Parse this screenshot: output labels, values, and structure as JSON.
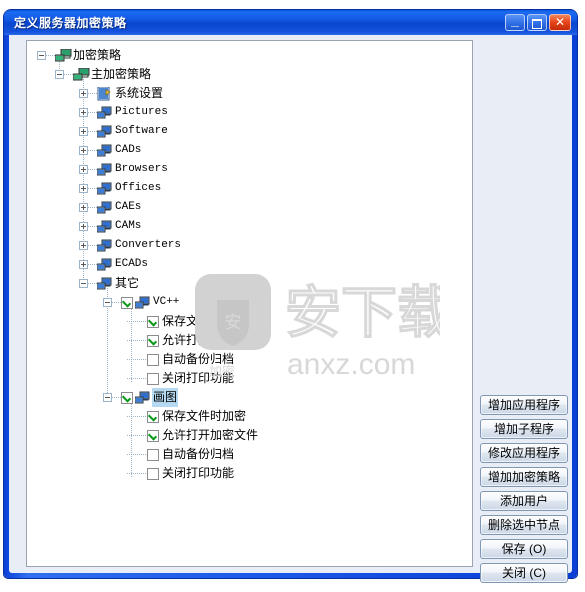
{
  "window": {
    "title": "定义服务器加密策略",
    "controls": {
      "minimize": "–",
      "maximize": "□",
      "close": "✕"
    }
  },
  "tree": {
    "nodes": [
      {
        "label": "加密策略",
        "level": 0,
        "expander": "minus",
        "icon": "policy-icon",
        "checkbox": "none",
        "selected": false,
        "mono": false
      },
      {
        "label": "主加密策略",
        "level": 1,
        "expander": "minus",
        "icon": "policy-icon",
        "checkbox": "none",
        "selected": false,
        "mono": false
      },
      {
        "label": "系统设置",
        "level": 2,
        "expander": "plus",
        "icon": "settings-icon",
        "checkbox": "none",
        "selected": false,
        "mono": false
      },
      {
        "label": "Pictures",
        "level": 2,
        "expander": "plus",
        "icon": "computer-icon",
        "checkbox": "none",
        "selected": false,
        "mono": true
      },
      {
        "label": "Software",
        "level": 2,
        "expander": "plus",
        "icon": "computer-icon",
        "checkbox": "none",
        "selected": false,
        "mono": true
      },
      {
        "label": "CADs",
        "level": 2,
        "expander": "plus",
        "icon": "computer-icon",
        "checkbox": "none",
        "selected": false,
        "mono": true
      },
      {
        "label": "Browsers",
        "level": 2,
        "expander": "plus",
        "icon": "computer-icon",
        "checkbox": "none",
        "selected": false,
        "mono": true
      },
      {
        "label": "Offices",
        "level": 2,
        "expander": "plus",
        "icon": "computer-icon",
        "checkbox": "none",
        "selected": false,
        "mono": true
      },
      {
        "label": "CAEs",
        "level": 2,
        "expander": "plus",
        "icon": "computer-icon",
        "checkbox": "none",
        "selected": false,
        "mono": true
      },
      {
        "label": "CAMs",
        "level": 2,
        "expander": "plus",
        "icon": "computer-icon",
        "checkbox": "none",
        "selected": false,
        "mono": true
      },
      {
        "label": "Converters",
        "level": 2,
        "expander": "plus",
        "icon": "computer-icon",
        "checkbox": "none",
        "selected": false,
        "mono": true
      },
      {
        "label": "ECADs",
        "level": 2,
        "expander": "plus",
        "icon": "computer-icon",
        "checkbox": "none",
        "selected": false,
        "mono": true
      },
      {
        "label": "其它",
        "level": 2,
        "expander": "minus",
        "icon": "computer-icon",
        "checkbox": "none",
        "selected": false,
        "mono": false
      },
      {
        "label": "VC++",
        "level": 3,
        "expander": "minus",
        "icon": "computer-icon",
        "checkbox": "checked",
        "selected": false,
        "mono": true
      },
      {
        "label": "保存文件时加密",
        "level": 4,
        "expander": "none",
        "icon": "none",
        "checkbox": "checked",
        "selected": false,
        "mono": false
      },
      {
        "label": "允许打开加密文件",
        "level": 4,
        "expander": "none",
        "icon": "none",
        "checkbox": "checked",
        "selected": false,
        "mono": false
      },
      {
        "label": "自动备份归档",
        "level": 4,
        "expander": "none",
        "icon": "none",
        "checkbox": "unchecked",
        "selected": false,
        "mono": false
      },
      {
        "label": "关闭打印功能",
        "level": 4,
        "expander": "none",
        "icon": "none",
        "checkbox": "unchecked",
        "selected": false,
        "mono": false
      },
      {
        "label": "画图",
        "level": 3,
        "expander": "minus",
        "icon": "computer-icon",
        "checkbox": "checked",
        "selected": true,
        "mono": false
      },
      {
        "label": "保存文件时加密",
        "level": 4,
        "expander": "none",
        "icon": "none",
        "checkbox": "checked",
        "selected": false,
        "mono": false
      },
      {
        "label": "允许打开加密文件",
        "level": 4,
        "expander": "none",
        "icon": "none",
        "checkbox": "checked",
        "selected": false,
        "mono": false
      },
      {
        "label": "自动备份归档",
        "level": 4,
        "expander": "none",
        "icon": "none",
        "checkbox": "unchecked",
        "selected": false,
        "mono": false
      },
      {
        "label": "关闭打印功能",
        "level": 4,
        "expander": "none",
        "icon": "none",
        "checkbox": "unchecked",
        "selected": false,
        "mono": false
      }
    ]
  },
  "buttons": [
    {
      "label": "增加应用程序",
      "name": "add-application-button"
    },
    {
      "label": "增加子程序",
      "name": "add-subprogram-button"
    },
    {
      "label": "修改应用程序",
      "name": "edit-application-button"
    },
    {
      "label": "增加加密策略",
      "name": "add-encryption-policy-button"
    },
    {
      "label": "添加用户",
      "name": "add-user-button"
    },
    {
      "label": "删除选中节点",
      "name": "delete-selected-node-button"
    },
    {
      "label": "保存 (O)",
      "name": "save-button"
    },
    {
      "label": "关闭 (C)",
      "name": "close-button"
    }
  ],
  "watermark": {
    "text_cn": "安下载",
    "text_en": "anxz.com",
    "badge_char": "安",
    "color": "#d5d5d5"
  },
  "colors": {
    "titlebar": "#1359e4",
    "dialog_bg": "#e9edf6",
    "tree_bg": "#ffffff",
    "selection": "#b5d9f0",
    "check": "#0a9a18"
  }
}
